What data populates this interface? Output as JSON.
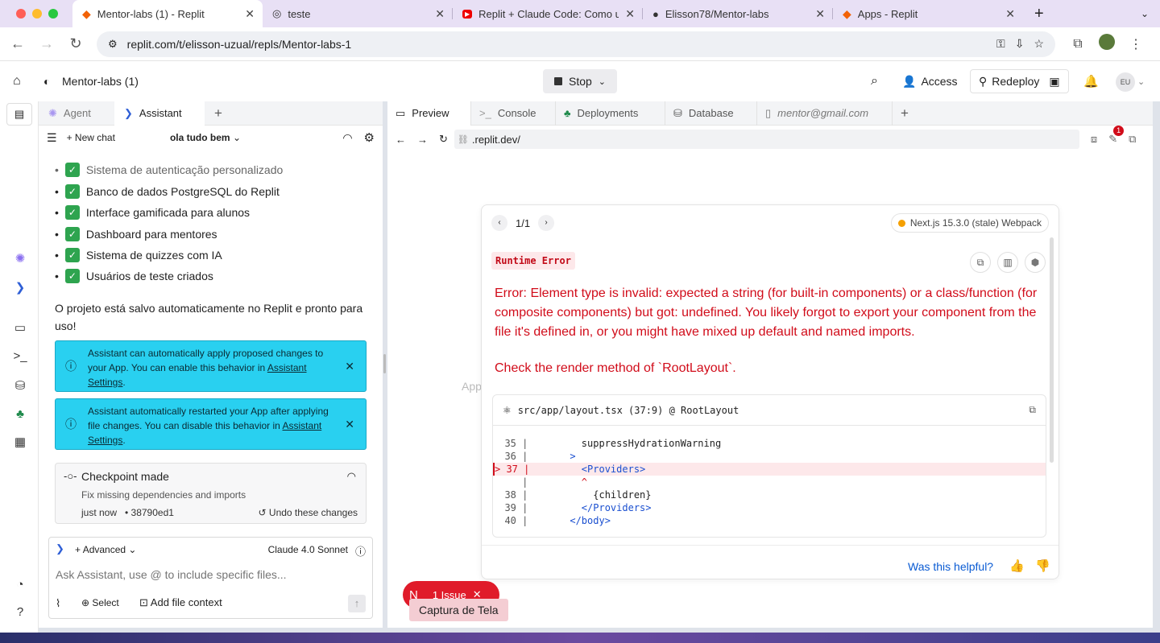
{
  "browser_tabs": [
    {
      "title": "Mentor-labs (1) - Replit",
      "icon": "replit-icon"
    },
    {
      "title": "teste",
      "icon": "globe-icon"
    },
    {
      "title": "Replit + Claude Code: Como u",
      "icon": "youtube-icon"
    },
    {
      "title": "Elisson78/Mentor-labs",
      "icon": "github-icon"
    },
    {
      "title": "Apps - Replit",
      "icon": "replit-icon"
    }
  ],
  "url": "replit.com/t/elisson-uzual/repls/Mentor-labs-1",
  "app": {
    "project_name": "Mentor-labs (1)",
    "stop_label": "Stop",
    "access_label": "Access",
    "redeploy_label": "Redeploy",
    "avatar": "EU"
  },
  "left_tabs": [
    "Agent",
    "Assistant"
  ],
  "chat": {
    "new_chat_label": "New chat",
    "chat_title": "ola tudo bem",
    "features": [
      "Sistema de autenticação personalizado",
      "Banco de dados PostgreSQL do Replit",
      "Interface gamificada para alunos",
      "Dashboard para mentores",
      "Sistema de quizzes com IA",
      "Usuários de teste criados"
    ],
    "saved_text": "O projeto está salvo automaticamente no Replit e pronto para uso!",
    "note1_text": "Assistant can automatically apply proposed changes to your App. You can enable this behavior in",
    "note2_text": "Assistant automatically restarted your App after applying file changes. You can disable this behavior in",
    "settings_link": "Assistant Settings",
    "settings_dot": ".",
    "checkpoint_title": "Checkpoint made",
    "checkpoint_desc": "Fix missing dependencies and imports",
    "checkpoint_time": "just now",
    "checkpoint_hash": "• 38790ed1",
    "undo_label": "Undo these changes",
    "advanced_label": "Advanced",
    "model_label": "Claude 4.0 Sonnet",
    "input_placeholder": "Ask Assistant, use @ to include specific files...",
    "select_label": "Select",
    "add_context_label": "Add file context"
  },
  "right_tabs": [
    "Preview",
    "Console",
    "Deployments",
    "Database",
    "mentor@gmail.com"
  ],
  "preview_url": ".replit.dev/",
  "issue_badge_count": "1",
  "error": {
    "pager": "1/1",
    "version": "Next.js 15.3.0 (stale) Webpack",
    "label": "Runtime Error",
    "message": "Error: Element type is invalid: expected a string (for built-in components) or a class/function (for composite components) but got: undefined. You likely forgot to export your component from the file it's defined in, or you might have mixed up default and named imports.",
    "check": "Check the render method of `RootLayout`.",
    "source": "src/app/layout.tsx (37:9) @ RootLayout",
    "code_lines": [
      {
        "gutter": "  35 |",
        "code": "        suppressHydrationWarning"
      },
      {
        "gutter": "  36 |",
        "code": "      >"
      },
      {
        "gutter": "> 37 |",
        "code": "        <Providers>"
      },
      {
        "gutter": "     |",
        "code": "        ^"
      },
      {
        "gutter": "  38 |",
        "code": "          {children}"
      },
      {
        "gutter": "  39 |",
        "code": "        </Providers>"
      },
      {
        "gutter": "  40 |",
        "code": "      </body>"
      }
    ],
    "helpful": "Was this helpful?"
  },
  "bg_partial": "App",
  "issue": {
    "letter": "N",
    "label": "1 Issue"
  },
  "tooltip": "Captura de Tela",
  "colors": {
    "accent_blue": "#0a5bd3",
    "error_red": "#d10c1a",
    "note_cyan": "#29d0f0",
    "replit_orange": "#f26207"
  }
}
